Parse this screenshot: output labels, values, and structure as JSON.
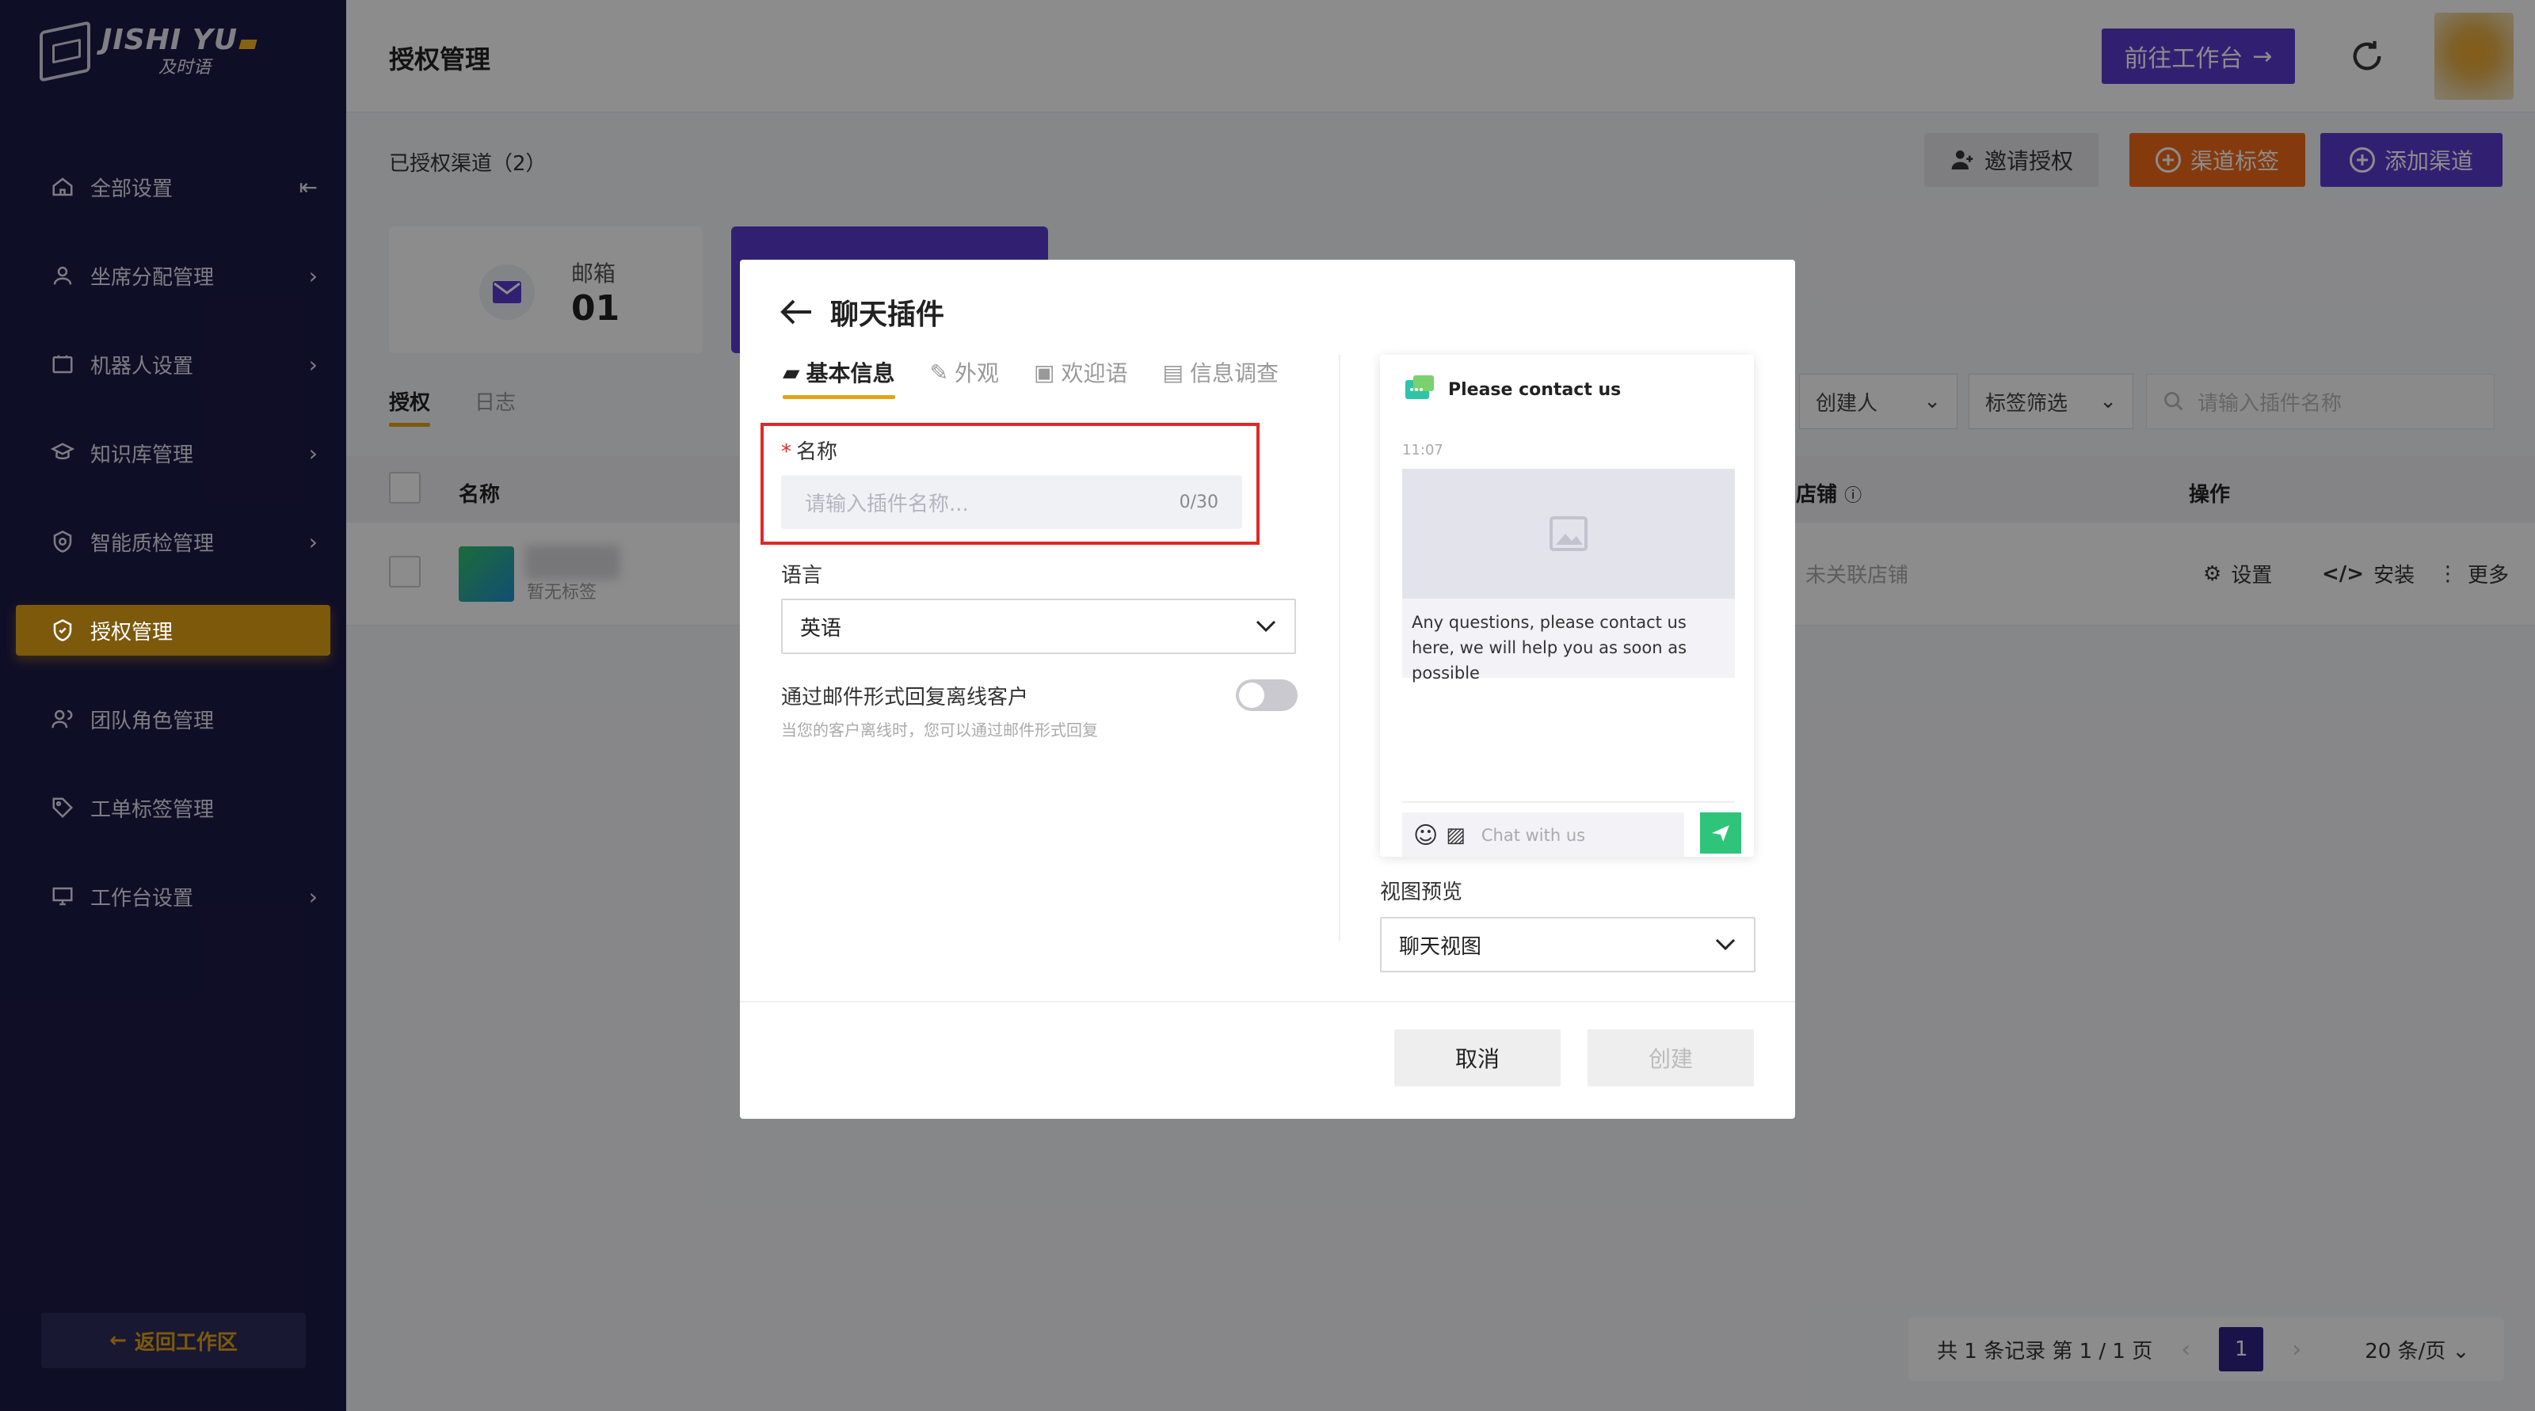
{
  "brand": {
    "name_en": "JISHI YU",
    "name_cn": "及时语"
  },
  "sidebar": {
    "items": [
      {
        "label": "全部设置",
        "icon": "home-icon",
        "has_arrow": false
      },
      {
        "label": "坐席分配管理",
        "icon": "user-icon",
        "has_arrow": true
      },
      {
        "label": "机器人设置",
        "icon": "robot-icon",
        "has_arrow": true
      },
      {
        "label": "知识库管理",
        "icon": "book-icon",
        "has_arrow": true
      },
      {
        "label": "智能质检管理",
        "icon": "shield-check-icon",
        "has_arrow": true
      },
      {
        "label": "授权管理",
        "icon": "shield-icon",
        "has_arrow": false,
        "active": true
      },
      {
        "label": "团队角色管理",
        "icon": "team-icon",
        "has_arrow": false
      },
      {
        "label": "工单标签管理",
        "icon": "tag-icon",
        "has_arrow": false
      },
      {
        "label": "工作台设置",
        "icon": "monitor-icon",
        "has_arrow": true
      }
    ],
    "back_label": "返回工作区"
  },
  "header": {
    "title": "授权管理",
    "goto_label": "前往工作台"
  },
  "toolbar": {
    "authorized_label": "已授权渠道（2）",
    "invite_label": "邀请授权",
    "tag_label": "渠道标签",
    "add_label": "添加渠道"
  },
  "channel_card": {
    "label": "邮箱",
    "count": "01"
  },
  "tabs": {
    "auth": "授权",
    "log": "日志"
  },
  "filters": {
    "creator": "创建人",
    "tag": "标签筛选",
    "search_placeholder": "请输入插件名称"
  },
  "table": {
    "headers": {
      "name": "名称",
      "store": "店铺",
      "actions": "操作"
    },
    "row": {
      "tag": "暂无标签",
      "store": "未关联店铺",
      "settings": "设置",
      "install": "安装",
      "more": "更多"
    }
  },
  "pagination": {
    "info": "共 1 条记录 第 1 / 1 页",
    "page": "1",
    "page_size": "20 条/页"
  },
  "modal": {
    "title": "聊天插件",
    "tabs": [
      "基本信息",
      "外观",
      "欢迎语",
      "信息调查"
    ],
    "name_label": "名称",
    "name_placeholder": "请输入插件名称...",
    "name_counter": "0/30",
    "language_label": "语言",
    "language_value": "英语",
    "email_reply_label": "通过邮件形式回复离线客户",
    "email_reply_hint": "当您的客户离线时，您可以通过邮件形式回复",
    "email_reply_enabled": false,
    "view_label": "视图预览",
    "view_value": "聊天视图",
    "cancel_label": "取消",
    "create_label": "创建"
  },
  "preview": {
    "title": "Please contact us",
    "time": "11:07",
    "message": "Any questions, please contact us here, we will help you as soon as possible",
    "input_placeholder": "Chat with us"
  },
  "colors": {
    "sidebar_bg": "#1d1a47",
    "accent": "#e3a316",
    "primary": "#5a3bd0",
    "orange": "#f26a1b",
    "send_green": "#2ec47a"
  }
}
